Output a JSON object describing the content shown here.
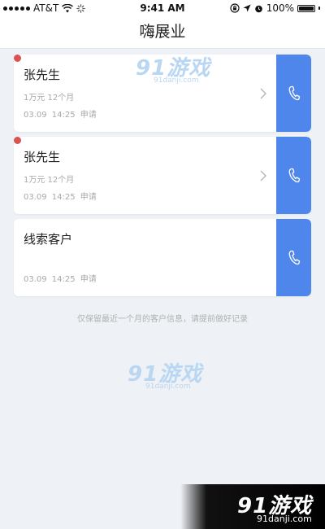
{
  "status_bar": {
    "carrier": "AT&T",
    "time": "9:41 AM",
    "battery": "100%",
    "battery_level": 1.0
  },
  "nav": {
    "title": "嗨展业"
  },
  "customers": [
    {
      "name": "张先生",
      "detail": "1万元 12个月",
      "time": "03.09  14:25 申请",
      "unread": true
    },
    {
      "name": "张先生",
      "detail": "1万元 12个月",
      "time": "03.09  14:25 申请",
      "unread": true
    },
    {
      "name": "线索客户",
      "detail": "",
      "time": "03.09  14:25 申请",
      "unread": false
    }
  ],
  "notice": "仅保留最近一个月的客户信息，请提前做好记录",
  "watermark": {
    "brand": "91游戏",
    "site": "91danji.com"
  },
  "colors": {
    "accent": "#4f86ec",
    "unread_dot": "#d9534f",
    "background": "#eef1f5"
  },
  "icons": {
    "call": "phone-icon",
    "chevron": "chevron-right-icon"
  }
}
